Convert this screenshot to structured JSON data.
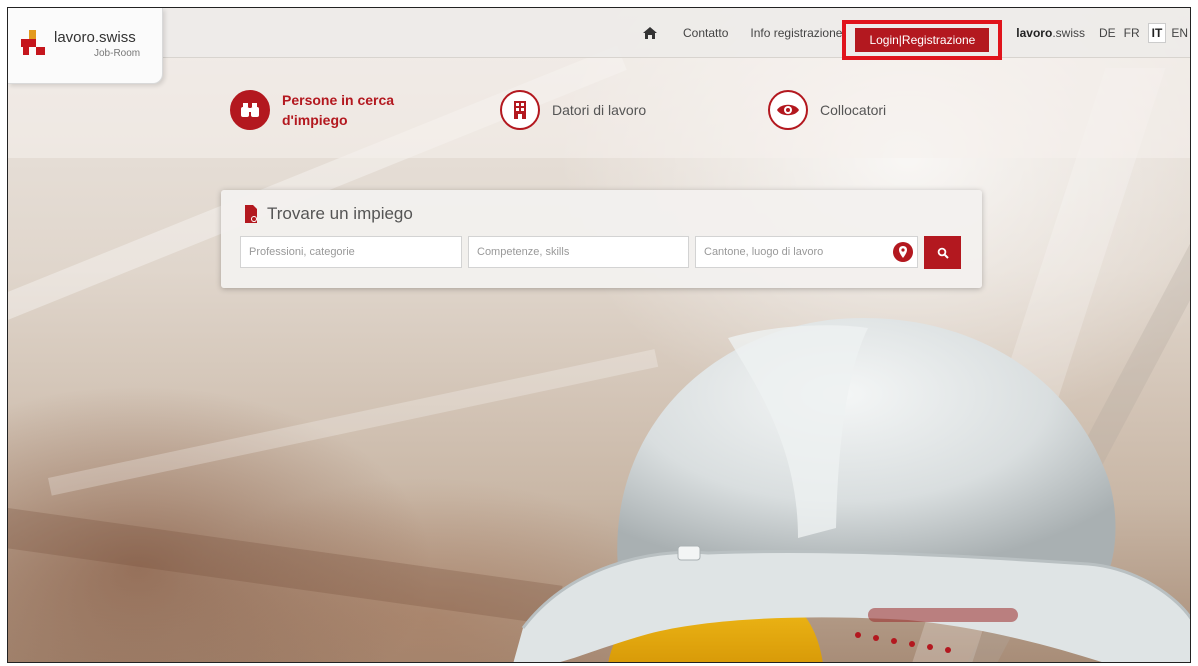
{
  "logo": {
    "name_bold": "lavoro",
    "name_rest": ".swiss",
    "subtitle": "Job-Room"
  },
  "nav": {
    "home_icon": "home-icon",
    "contact": "Contatto",
    "info": "Info registrazione",
    "login": "Login|Registrazione",
    "brand_bold": "lavoro",
    "brand_rest": ".swiss",
    "languages": [
      "DE",
      "FR",
      "IT",
      "EN"
    ],
    "active_language": "IT"
  },
  "categories": [
    {
      "label_line1": "Persone in cerca",
      "label_line2": "d'impiego",
      "icon": "binoculars-icon",
      "active": true
    },
    {
      "label_line1": "Datori di lavoro",
      "label_line2": "",
      "icon": "building-icon",
      "active": false
    },
    {
      "label_line1": "Collocatori",
      "label_line2": "",
      "icon": "eye-icon",
      "active": false
    }
  ],
  "search": {
    "title": "Trovare un impiego",
    "occupation_placeholder": "Professioni, categorie",
    "skills_placeholder": "Competenze, skills",
    "location_placeholder": "Cantone, luogo di lavoro",
    "location_icon": "map-pin-icon",
    "submit_icon": "search-icon"
  },
  "colors": {
    "accent": "#b3181f",
    "highlight_box": "#e0141c"
  }
}
